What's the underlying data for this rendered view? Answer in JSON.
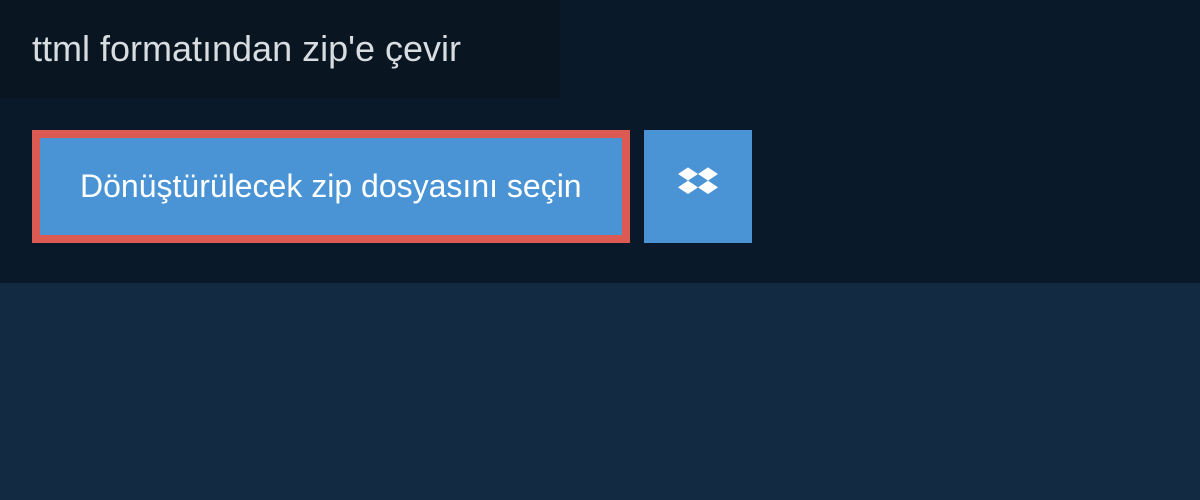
{
  "header": {
    "title": "ttml formatından zip'e çevir"
  },
  "actions": {
    "select_file_label": "Dönüştürülecek zip dosyasını seçin"
  },
  "colors": {
    "page_bg": "#122a42",
    "panel_bg": "#0a1929",
    "titlebar_bg": "#091521",
    "button_bg": "#4a94d6",
    "button_border": "#db5a52",
    "text_light": "#d8dde2",
    "text_white": "#ffffff"
  }
}
